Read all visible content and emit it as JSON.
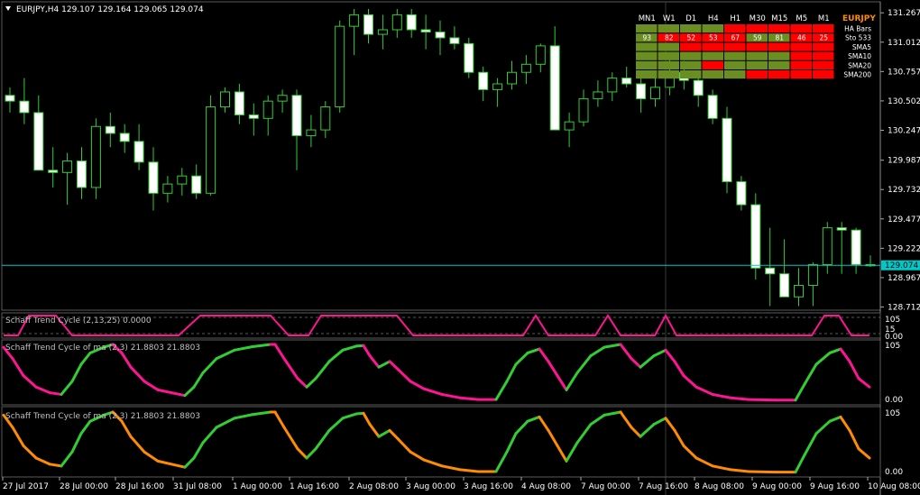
{
  "header": {
    "symbol": "EURJPY,H4",
    "ohlc": "129.107 129.164 129.065 129.074"
  },
  "price_axis": {
    "ticks": [
      "131.267",
      "131.012",
      "130.757",
      "130.502",
      "130.247",
      "129.987",
      "129.732",
      "129.477",
      "129.222",
      "128.967",
      "128.712"
    ],
    "current": "129.074",
    "min": 128.712,
    "max": 131.267,
    "current_value": 129.074
  },
  "time_axis": {
    "labels": [
      "27 Jul 2017",
      "28 Jul 00:00",
      "28 Jul 16:00",
      "31 Jul 08:00",
      "1 Aug 00:00",
      "1 Aug 16:00",
      "2 Aug 08:00",
      "3 Aug 00:00",
      "3 Aug 16:00",
      "4 Aug 08:00",
      "7 Aug 00:00",
      "7 Aug 16:00",
      "8 Aug 08:00",
      "9 Aug 00:00",
      "9 Aug 16:00",
      "10 Aug 08:00"
    ]
  },
  "dashboard": {
    "symbol": "EURJPY",
    "timeframes": [
      "MN1",
      "W1",
      "D1",
      "H4",
      "H1",
      "M30",
      "M15",
      "M5",
      "M1"
    ],
    "rows": [
      {
        "label": "HA Bars",
        "cells": [
          "g",
          "g",
          "g",
          "g",
          "r",
          "r",
          "r",
          "r",
          "r"
        ],
        "values": [
          "",
          "",
          "",
          "",
          "",
          "",
          "",
          "",
          ""
        ]
      },
      {
        "label": "Sto 533",
        "cells": [
          "g",
          "r",
          "r",
          "r",
          "r",
          "g",
          "g",
          "r",
          "r"
        ],
        "values": [
          "93",
          "82",
          "52",
          "53",
          "67",
          "59",
          "81",
          "46",
          "25"
        ]
      },
      {
        "label": "SMA5",
        "cells": [
          "g",
          "g",
          "r",
          "r",
          "r",
          "r",
          "r",
          "r",
          "r"
        ],
        "values": [
          "",
          "",
          "",
          "",
          "",
          "",
          "",
          "",
          ""
        ]
      },
      {
        "label": "SMA10",
        "cells": [
          "g",
          "g",
          "g",
          "g",
          "g",
          "g",
          "g",
          "r",
          "r"
        ],
        "values": [
          "",
          "",
          "",
          "",
          "",
          "",
          "",
          "",
          ""
        ]
      },
      {
        "label": "SMA20",
        "cells": [
          "g",
          "g",
          "g",
          "r",
          "g",
          "g",
          "g",
          "r",
          "r"
        ],
        "values": [
          "",
          "",
          "",
          "",
          "",
          "",
          "",
          "",
          ""
        ]
      },
      {
        "label": "SMA200",
        "cells": [
          "g",
          "g",
          "g",
          "g",
          "g",
          "r",
          "r",
          "r",
          "r"
        ],
        "values": [
          "",
          "",
          "",
          "",
          "",
          "",
          "",
          "",
          ""
        ]
      }
    ],
    "colors": {
      "g": "#6b8e23",
      "r": "#ff0000",
      "symbol": "#ff8c00"
    }
  },
  "indicators": [
    {
      "title": "Schaff Trend Cycle (2,13,25) 0.0000",
      "top_label": "105",
      "mid_label": "15",
      "bottom_label": "0.00",
      "color": "#ff1493"
    },
    {
      "title": "Schaff Trend Cycle of ma (2,3) 21.8803 21.8803",
      "top_label": "105",
      "bottom_label": "0.00",
      "up_color": "#32cd32",
      "down_color": "#ff1493"
    },
    {
      "title": "Schaff Trend Cycle of ma (2,3) 21.8803 21.8803",
      "top_label": "105",
      "bottom_label": "0.00",
      "up_color": "#32cd32",
      "down_color": "#ff8c00"
    }
  ],
  "chart_data": {
    "type": "candlestick",
    "candles": [
      [
        130.55,
        130.62,
        130.4,
        130.5
      ],
      [
        130.5,
        130.7,
        130.3,
        130.4
      ],
      [
        130.4,
        130.55,
        129.9,
        129.9
      ],
      [
        129.9,
        130.1,
        129.75,
        129.88
      ],
      [
        129.88,
        130.05,
        129.6,
        129.98
      ],
      [
        129.98,
        130.1,
        129.65,
        129.75
      ],
      [
        129.75,
        130.35,
        129.65,
        130.28
      ],
      [
        130.28,
        130.4,
        130.1,
        130.22
      ],
      [
        130.22,
        130.3,
        130.05,
        130.15
      ],
      [
        130.15,
        130.3,
        129.9,
        129.97
      ],
      [
        129.97,
        130.1,
        129.55,
        129.7
      ],
      [
        129.7,
        129.85,
        129.62,
        129.78
      ],
      [
        129.78,
        129.92,
        129.68,
        129.85
      ],
      [
        129.85,
        129.95,
        129.65,
        129.7
      ],
      [
        129.7,
        130.55,
        129.68,
        130.45
      ],
      [
        130.45,
        130.62,
        130.4,
        130.58
      ],
      [
        130.58,
        130.65,
        130.3,
        130.38
      ],
      [
        130.38,
        130.48,
        130.2,
        130.35
      ],
      [
        130.35,
        130.55,
        130.2,
        130.5
      ],
      [
        130.5,
        130.6,
        130.4,
        130.55
      ],
      [
        130.55,
        130.6,
        129.9,
        130.2
      ],
      [
        130.2,
        130.38,
        130.1,
        130.25
      ],
      [
        130.25,
        130.5,
        130.18,
        130.45
      ],
      [
        130.45,
        131.2,
        130.4,
        131.15
      ],
      [
        131.15,
        131.3,
        130.9,
        131.25
      ],
      [
        131.25,
        131.3,
        131.0,
        131.08
      ],
      [
        131.08,
        131.25,
        130.95,
        131.12
      ],
      [
        131.12,
        131.3,
        131.05,
        131.25
      ],
      [
        131.25,
        131.3,
        131.05,
        131.12
      ],
      [
        131.12,
        131.25,
        130.95,
        131.1
      ],
      [
        131.1,
        131.2,
        130.9,
        131.05
      ],
      [
        131.05,
        131.15,
        130.95,
        131.0
      ],
      [
        131.0,
        131.05,
        130.7,
        130.75
      ],
      [
        130.75,
        130.8,
        130.5,
        130.6
      ],
      [
        130.6,
        130.7,
        130.45,
        130.65
      ],
      [
        130.65,
        130.85,
        130.6,
        130.75
      ],
      [
        130.75,
        130.9,
        130.65,
        130.82
      ],
      [
        130.82,
        131.0,
        130.75,
        130.98
      ],
      [
        130.98,
        131.15,
        130.8,
        130.25
      ],
      [
        130.25,
        130.4,
        130.1,
        130.32
      ],
      [
        130.32,
        130.6,
        130.28,
        130.52
      ],
      [
        130.52,
        130.68,
        130.45,
        130.58
      ],
      [
        130.58,
        130.75,
        130.5,
        130.7
      ],
      [
        130.7,
        130.8,
        130.62,
        130.65
      ],
      [
        130.65,
        130.75,
        130.4,
        130.52
      ],
      [
        130.52,
        130.7,
        130.45,
        130.62
      ],
      [
        130.62,
        130.88,
        130.55,
        130.75
      ],
      [
        130.75,
        130.85,
        130.6,
        130.68
      ],
      [
        130.68,
        130.75,
        130.45,
        130.55
      ],
      [
        130.55,
        130.6,
        130.3,
        130.35
      ],
      [
        130.35,
        130.45,
        129.7,
        129.8
      ],
      [
        129.8,
        129.85,
        129.55,
        129.6
      ],
      [
        129.6,
        129.7,
        128.95,
        129.05
      ],
      [
        129.05,
        129.4,
        128.72,
        129.0
      ],
      [
        129.0,
        129.3,
        128.8,
        128.8
      ],
      [
        128.8,
        129.05,
        128.72,
        128.9
      ],
      [
        128.9,
        129.1,
        128.72,
        129.08
      ],
      [
        129.08,
        129.45,
        129.0,
        129.4
      ],
      [
        129.4,
        129.45,
        129.0,
        129.38
      ],
      [
        129.38,
        129.4,
        129.0,
        129.08
      ],
      [
        129.08,
        129.16,
        129.06,
        129.07
      ]
    ]
  }
}
